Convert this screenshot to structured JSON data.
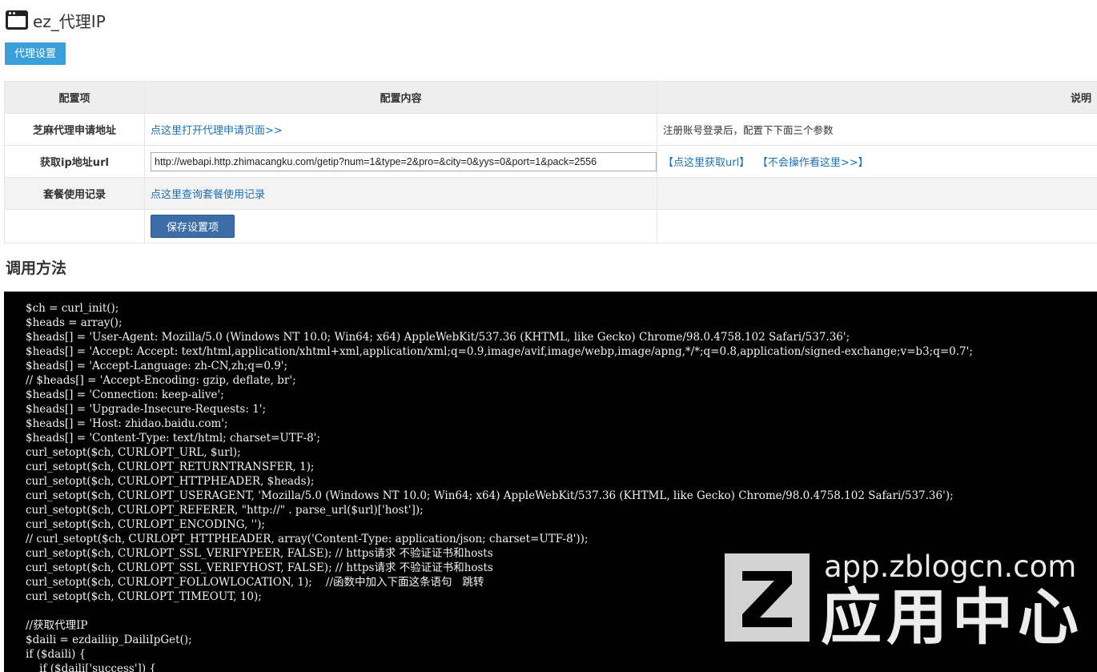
{
  "app": {
    "title": "ez_代理IP",
    "icon": "app-window-icon"
  },
  "tabs": [
    {
      "label": "代理设置",
      "active": true
    }
  ],
  "config_table": {
    "headers": {
      "item": "配置项",
      "content": "配置内容",
      "desc": "说明"
    },
    "rows": [
      {
        "label": "芝麻代理申请地址",
        "link": "点这里打开代理申请页面>>",
        "desc": "注册账号登录后，配置下下面三个参数"
      },
      {
        "label": "获取ip地址url",
        "url_value": "http://webapi.http.zhimacangku.com/getip?num=1&type=2&pro=&city=0&yys=0&port=1&pack=2556",
        "link_get_url": "【点这里获取url】",
        "link_help": "【不会操作看这里>>】"
      },
      {
        "label": "套餐使用记录",
        "link": "点这里查询套餐使用记录"
      }
    ],
    "save_label": "保存设置项"
  },
  "section_title": "调用方法",
  "code": "$ch = curl_init();\n$heads = array();\n$heads[] = 'User-Agent: Mozilla/5.0 (Windows NT 10.0; Win64; x64) AppleWebKit/537.36 (KHTML, like Gecko) Chrome/98.0.4758.102 Safari/537.36';\n$heads[] = 'Accept: Accept: text/html,application/xhtml+xml,application/xml;q=0.9,image/avif,image/webp,image/apng,*/*;q=0.8,application/signed-exchange;v=b3;q=0.7';\n$heads[] = 'Accept-Language: zh-CN,zh;q=0.9';\n// $heads[] = 'Accept-Encoding: gzip, deflate, br';\n$heads[] = 'Connection: keep-alive';\n$heads[] = 'Upgrade-Insecure-Requests: 1';\n$heads[] = 'Host: zhidao.baidu.com';\n$heads[] = 'Content-Type: text/html; charset=UTF-8';\ncurl_setopt($ch, CURLOPT_URL, $url);\ncurl_setopt($ch, CURLOPT_RETURNTRANSFER, 1);\ncurl_setopt($ch, CURLOPT_HTTPHEADER, $heads);\ncurl_setopt($ch, CURLOPT_USERAGENT, 'Mozilla/5.0 (Windows NT 10.0; Win64; x64) AppleWebKit/537.36 (KHTML, like Gecko) Chrome/98.0.4758.102 Safari/537.36');\ncurl_setopt($ch, CURLOPT_REFERER, \"http://\" . parse_url($url)['host']);\ncurl_setopt($ch, CURLOPT_ENCODING, '');\n// curl_setopt($ch, CURLOPT_HTTPHEADER, array('Content-Type: application/json; charset=UTF-8'));\ncurl_setopt($ch, CURLOPT_SSL_VERIFYPEER, FALSE); // https请求 不验证证书和hosts\ncurl_setopt($ch, CURLOPT_SSL_VERIFYHOST, FALSE); // https请求 不验证证书和hosts\ncurl_setopt($ch, CURLOPT_FOLLOWLOCATION, 1);    //函数中加入下面这条语句   跳转\ncurl_setopt($ch, CURLOPT_TIMEOUT, 10);\n\n//获取代理IP\n$daili = ezdailiip_DailiIpGet();\nif ($daili) {\n    if ($daili['success']) {",
  "watermark": {
    "url": "app.zblogcn.com",
    "name": "应用中心",
    "logo_letter": "Z"
  },
  "colors": {
    "tab_bg": "#3a9fd8",
    "save_bg": "#3c6da6",
    "link": "#1f6fb3",
    "code_bg": "#000000"
  }
}
